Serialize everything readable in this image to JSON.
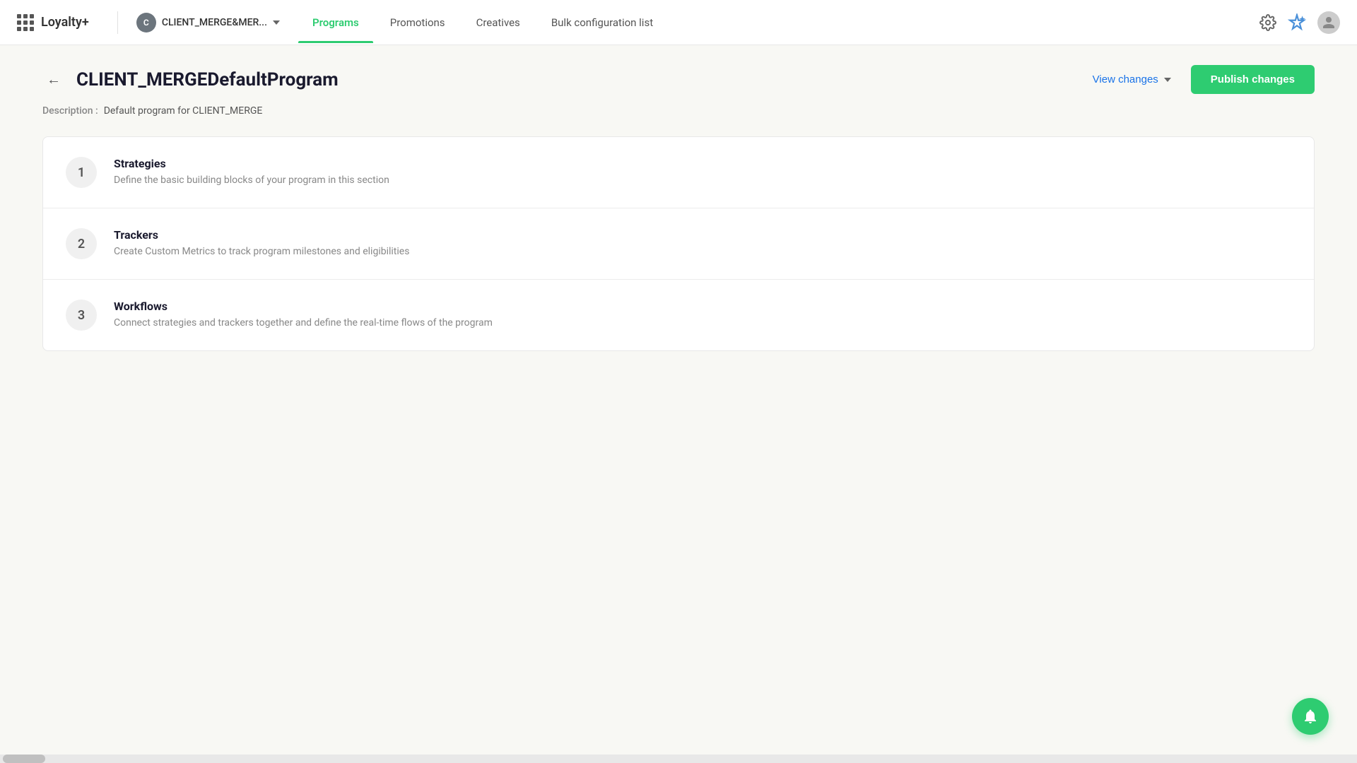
{
  "app": {
    "logo": "Loyalty+",
    "grid_icon_label": "apps-icon"
  },
  "client": {
    "avatar_letter": "C",
    "name": "CLIENT_MERGE&MER...",
    "chevron_label": "dropdown-icon"
  },
  "nav": {
    "items": [
      {
        "id": "programs",
        "label": "Programs",
        "active": true
      },
      {
        "id": "promotions",
        "label": "Promotions",
        "active": false
      },
      {
        "id": "creatives",
        "label": "Creatives",
        "active": false
      },
      {
        "id": "bulk-config",
        "label": "Bulk configuration list",
        "active": false
      }
    ]
  },
  "header": {
    "back_label": "←",
    "title": "CLIENT_MERGEDefaultProgram",
    "view_changes_label": "View changes",
    "publish_label": "Publish changes"
  },
  "description": {
    "label": "Description :",
    "value": "Default program for CLIENT_MERGE"
  },
  "sections": [
    {
      "number": "1",
      "title": "Strategies",
      "description": "Define the basic building blocks of your program in this section"
    },
    {
      "number": "2",
      "title": "Trackers",
      "description": "Create Custom Metrics to track program milestones and eligibilities"
    },
    {
      "number": "3",
      "title": "Workflows",
      "description": "Connect strategies and trackers together and define the real-time flows of the program"
    }
  ],
  "notification": {
    "bell_label": "notification-bell"
  }
}
